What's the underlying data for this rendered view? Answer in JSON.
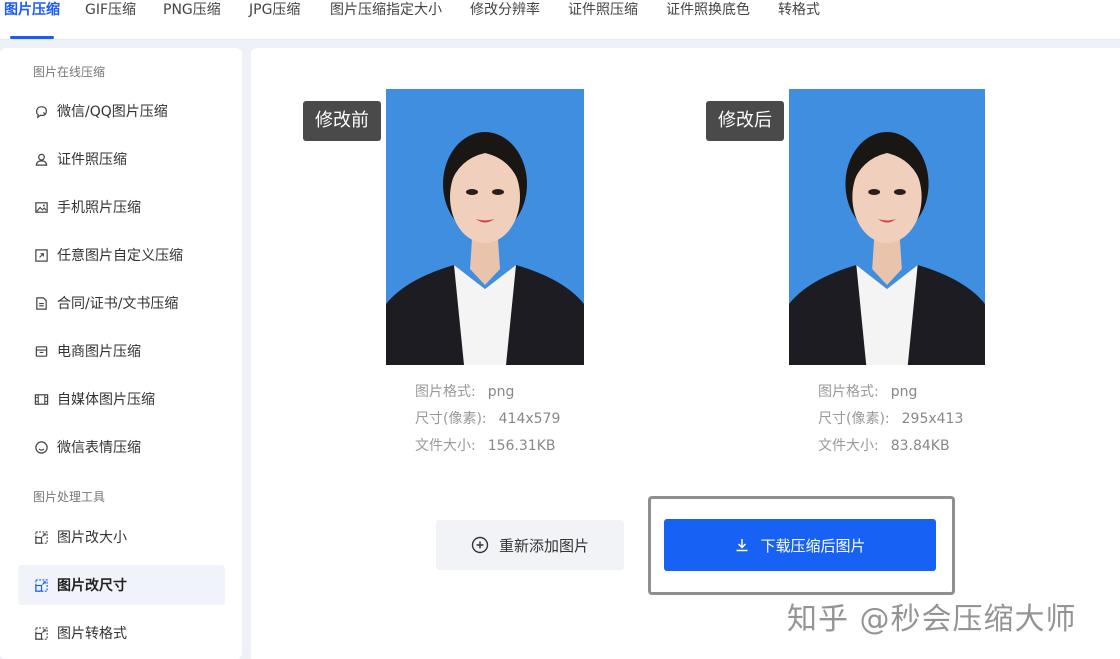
{
  "tabs": [
    {
      "label": "图片压缩",
      "active": true
    },
    {
      "label": "GIF压缩"
    },
    {
      "label": "PNG压缩"
    },
    {
      "label": "JPG压缩"
    },
    {
      "label": "图片压缩指定大小"
    },
    {
      "label": "修改分辨率"
    },
    {
      "label": "证件照压缩"
    },
    {
      "label": "证件照换底色"
    },
    {
      "label": "转格式"
    }
  ],
  "sidebar": {
    "section1_title": "图片在线压缩",
    "section2_title": "图片处理工具",
    "items": [
      {
        "label": "微信/QQ图片压缩",
        "icon": "chat-icon"
      },
      {
        "label": "证件照压缩",
        "icon": "user-icon"
      },
      {
        "label": "手机照片压缩",
        "icon": "image-icon"
      },
      {
        "label": "任意图片自定义压缩",
        "icon": "resize-icon"
      },
      {
        "label": "合同/证书/文书压缩",
        "icon": "document-icon"
      },
      {
        "label": "电商图片压缩",
        "icon": "shop-icon"
      },
      {
        "label": "自媒体图片压缩",
        "icon": "film-icon"
      },
      {
        "label": "微信表情压缩",
        "icon": "smile-icon"
      }
    ],
    "tools": [
      {
        "label": "图片改大小",
        "icon": "resize-image-icon"
      },
      {
        "label": "图片改尺寸",
        "icon": "resize-image-icon",
        "active": true
      },
      {
        "label": "图片转格式",
        "icon": "resize-image-icon"
      }
    ]
  },
  "before": {
    "tag": "修改前",
    "format_label": "图片格式:",
    "format_value": "png",
    "size_label": "尺寸(像素):",
    "size_value": "414x579",
    "filesize_label": "文件大小:",
    "filesize_value": "156.31KB"
  },
  "after": {
    "tag": "修改后",
    "format_label": "图片格式:",
    "format_value": "png",
    "size_label": "尺寸(像素):",
    "size_value": "295x413",
    "filesize_label": "文件大小:",
    "filesize_value": "83.84KB"
  },
  "buttons": {
    "readd": "重新添加图片",
    "download": "下载压缩后图片"
  },
  "watermark": "知乎 @秒会压缩大师",
  "colors": {
    "accent": "#1762f5",
    "photo_bg": "#3f8ee0"
  }
}
